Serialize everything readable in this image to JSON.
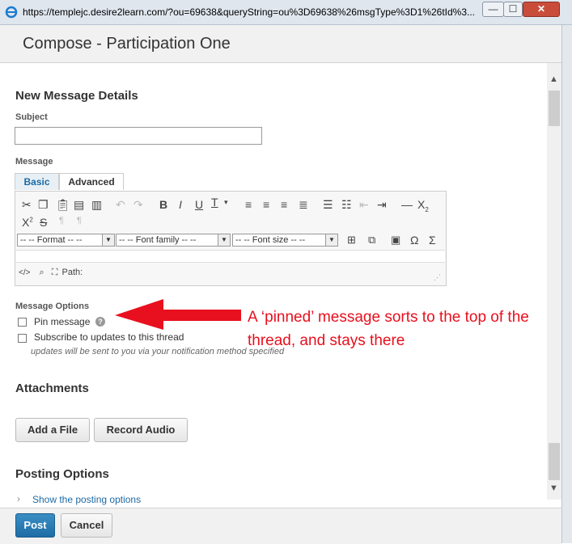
{
  "browser": {
    "url": "https://templejc.desire2learn.com/?ou=69638&queryString=ou%3D69638%26msgType%3D1%26tId%3..."
  },
  "window_controls": {
    "minimize": "—",
    "maximize": "☐",
    "close": "✕"
  },
  "dialog": {
    "title": "Compose - Participation One"
  },
  "details": {
    "heading": "New Message Details",
    "subject_label": "Subject",
    "subject_value": "",
    "message_label": "Message"
  },
  "editor": {
    "tabs": [
      "Basic",
      "Advanced"
    ],
    "active_tab": "Basic",
    "format_select": "-- -- Format -- --",
    "font_family_select": "-- -- Font family -- --",
    "font_size_select": "-- -- Font size -- --",
    "path_label": "Path:"
  },
  "options": {
    "heading": "Message Options",
    "pin_label": "Pin message",
    "pin_checked": false,
    "subscribe_label": "Subscribe to updates to this thread",
    "subscribe_checked": false,
    "subscribe_hint": "updates will be sent to you via your notification method specified"
  },
  "attachments": {
    "heading": "Attachments",
    "add_file": "Add a File",
    "record_audio": "Record Audio"
  },
  "posting": {
    "heading": "Posting Options",
    "show_link": "Show the posting options"
  },
  "footer": {
    "post": "Post",
    "cancel": "Cancel"
  },
  "annotation": {
    "text": "A ‘pinned’ message sorts to the top of the thread, and stays there",
    "color": "#e8101e"
  },
  "colors": {
    "accent": "#1d6aa5"
  }
}
